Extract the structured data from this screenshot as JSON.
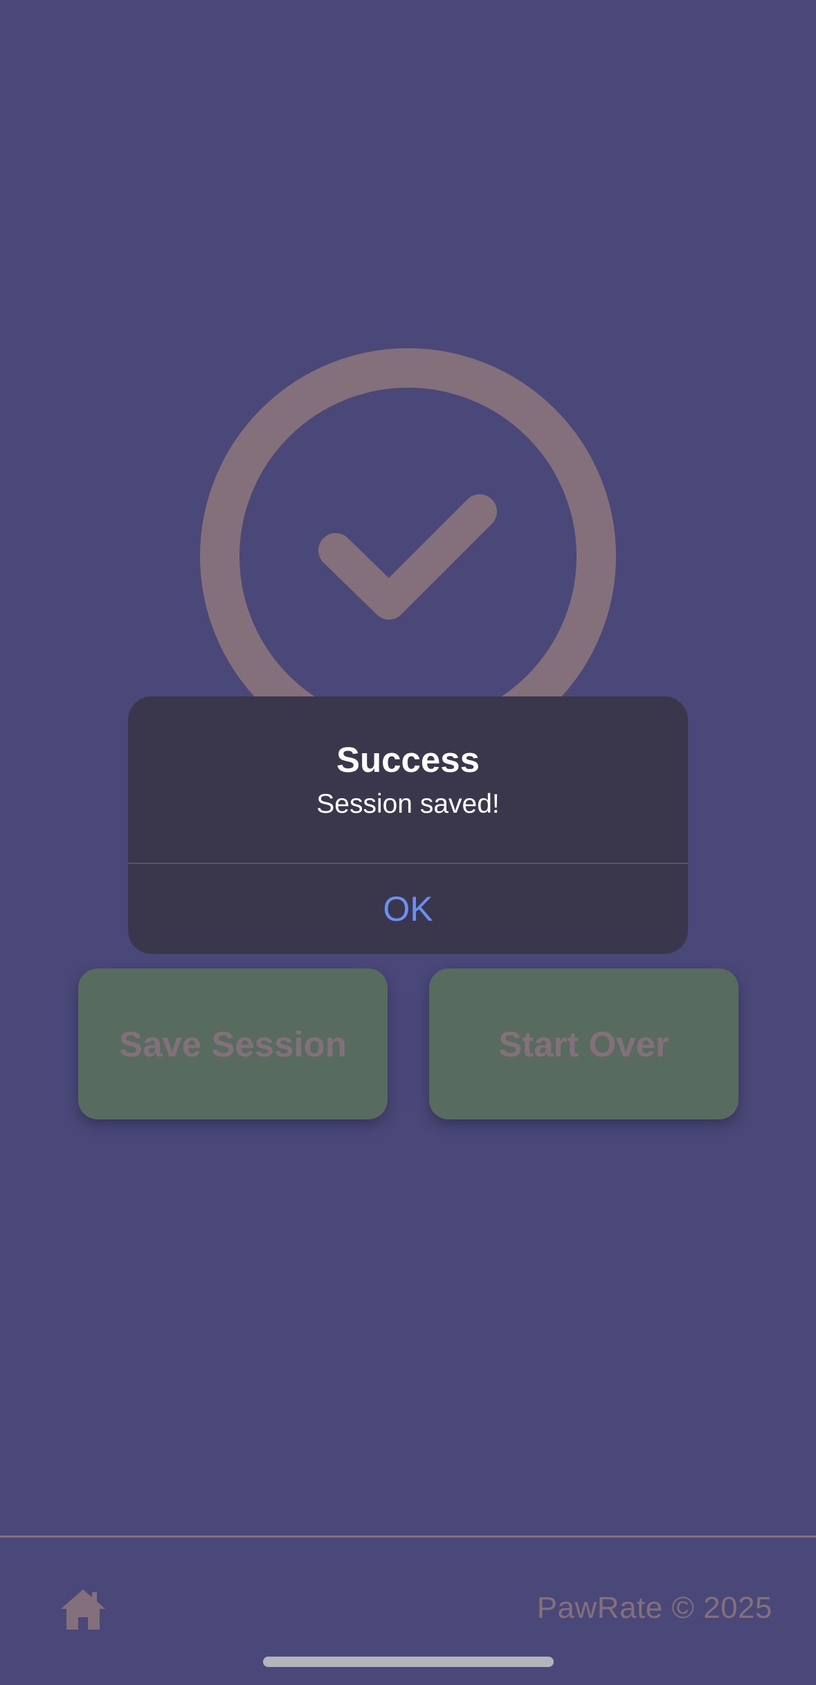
{
  "app": {
    "name": "PawRate",
    "background_color": "#4a4878",
    "muted_color": "#83707a",
    "button_color": "#586b5f"
  },
  "main": {
    "status_icon": "checkmark-circle-icon",
    "buttons": {
      "save_label": "Save Session",
      "start_over_label": "Start Over"
    }
  },
  "footer": {
    "home_icon": "home-icon",
    "copyright": "PawRate © 2025"
  },
  "alert": {
    "title": "Success",
    "message": "Session saved!",
    "ok_label": "OK",
    "ok_color": "#6c8ff2",
    "background_color": "#3a364b"
  }
}
